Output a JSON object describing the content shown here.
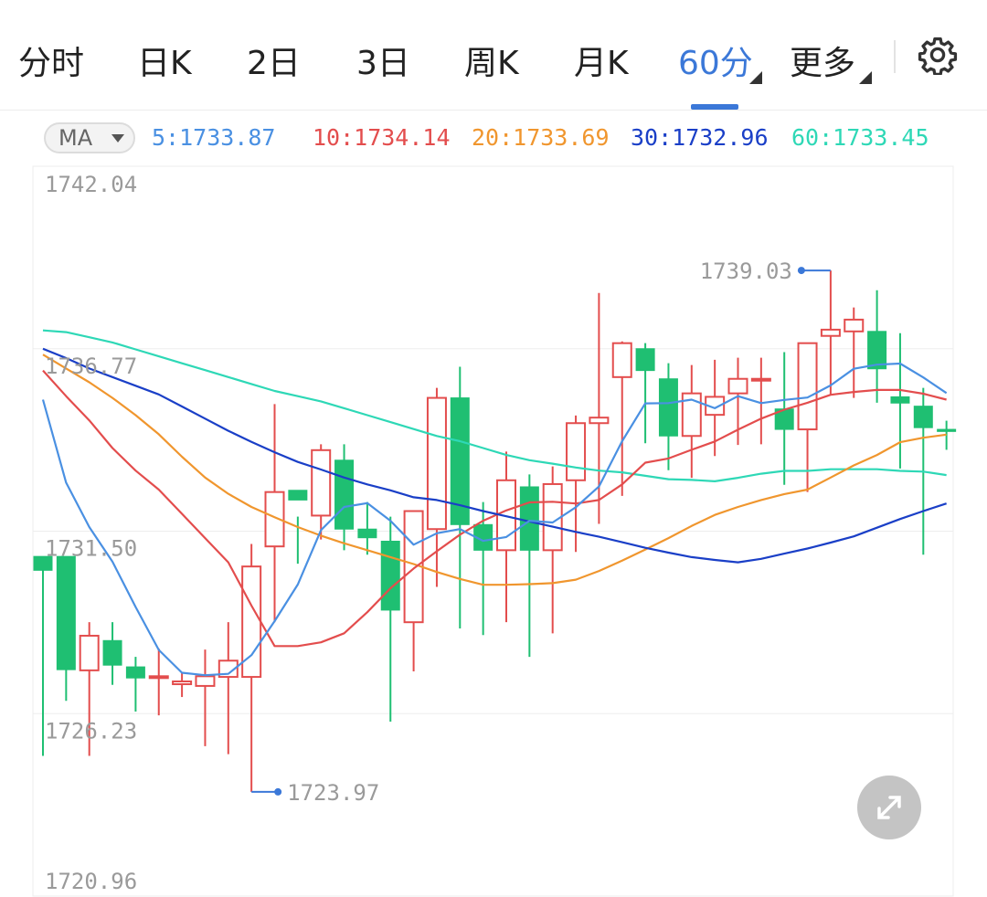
{
  "tabs": [
    {
      "label": "分时",
      "active": false
    },
    {
      "label": "日K",
      "active": false
    },
    {
      "label": "2日",
      "active": false
    },
    {
      "label": "3日",
      "active": false
    },
    {
      "label": "周K",
      "active": false
    },
    {
      "label": "月K",
      "active": false
    },
    {
      "label": "60分",
      "active": true
    },
    {
      "label": "更多",
      "active": false
    }
  ],
  "icons": {
    "settings": "gear-icon",
    "expand": "expand-arrows-icon",
    "dropdown": "caret-down-icon"
  },
  "indicator": {
    "label": "MA",
    "values": [
      {
        "text": "5:1733.87",
        "color": "#4a90e2"
      },
      {
        "text": "10:1734.14",
        "color": "#e34d4d"
      },
      {
        "text": "20:1733.69",
        "color": "#f0962e"
      },
      {
        "text": "30:1732.96",
        "color": "#1a3fc7"
      },
      {
        "text": "60:1733.45",
        "color": "#2ed8b6"
      }
    ]
  },
  "colors": {
    "up": "#e34d4d",
    "down": "#1fbf72",
    "accent": "#3b78d8"
  },
  "chart_data": {
    "type": "candlestick",
    "ylim": [
      1720.96,
      1742.04
    ],
    "y_ticks": [
      "1742.04",
      "1736.77",
      "1731.50",
      "1726.23",
      "1720.96"
    ],
    "annotations": {
      "high": "1739.03",
      "low": "1723.97"
    },
    "candles": [
      [
        1730.77,
        1730.37,
        1725.01,
        1730.77
      ],
      [
        1730.77,
        1727.5,
        1726.6,
        1730.77
      ],
      [
        1727.48,
        1728.48,
        1725.01,
        1728.87
      ],
      [
        1728.34,
        1727.63,
        1727.06,
        1728.87
      ],
      [
        1727.58,
        1727.26,
        1726.29,
        1727.87
      ],
      [
        1727.26,
        1727.31,
        1726.18,
        1728.11
      ],
      [
        1727.08,
        1727.16,
        1726.71,
        1727.4
      ],
      [
        1727.03,
        1727.31,
        1725.29,
        1728.08
      ],
      [
        1727.29,
        1727.76,
        1725.06,
        1728.87
      ],
      [
        1727.29,
        1730.48,
        1723.97,
        1731.13
      ],
      [
        1731.06,
        1732.63,
        1728.87,
        1735.17
      ],
      [
        1732.68,
        1732.4,
        1730.56,
        1731.92
      ],
      [
        1731.95,
        1733.84,
        1731.26,
        1734.01
      ],
      [
        1733.55,
        1731.56,
        1730.95,
        1734.01
      ],
      [
        1731.56,
        1731.31,
        1730.82,
        1732.34
      ],
      [
        1731.21,
        1729.22,
        1726.0,
        1731.92
      ],
      [
        1728.87,
        1732.08,
        1727.45,
        1731.92
      ],
      [
        1731.56,
        1735.35,
        1729.89,
        1735.64
      ],
      [
        1735.35,
        1731.69,
        1728.69,
        1736.25
      ],
      [
        1731.69,
        1730.95,
        1728.5,
        1732.34
      ],
      [
        1730.95,
        1732.97,
        1728.87,
        1733.8
      ],
      [
        1732.78,
        1730.95,
        1727.87,
        1733.14
      ],
      [
        1730.95,
        1732.86,
        1728.55,
        1733.37
      ],
      [
        1732.97,
        1734.62,
        1730.9,
        1734.84
      ],
      [
        1734.62,
        1734.78,
        1731.71,
        1738.38
      ],
      [
        1735.95,
        1736.93,
        1732.52,
        1736.98
      ],
      [
        1736.77,
        1736.14,
        1734.04,
        1736.93
      ],
      [
        1735.9,
        1734.25,
        1733.26,
        1736.35
      ],
      [
        1734.25,
        1735.48,
        1733.04,
        1736.3
      ],
      [
        1734.86,
        1735.38,
        1733.67,
        1736.45
      ],
      [
        1735.48,
        1735.9,
        1733.99,
        1736.51
      ],
      [
        1735.9,
        1735.9,
        1734.01,
        1736.51
      ],
      [
        1735.03,
        1734.44,
        1732.84,
        1736.67
      ],
      [
        1734.44,
        1736.93,
        1732.63,
        1736.93
      ],
      [
        1737.14,
        1737.32,
        1735.43,
        1739.03
      ],
      [
        1737.27,
        1737.61,
        1735.35,
        1737.96
      ],
      [
        1737.27,
        1736.19,
        1735.21,
        1738.46
      ],
      [
        1735.38,
        1735.2,
        1733.31,
        1737.22
      ],
      [
        1735.11,
        1734.49,
        1730.82,
        1735.64
      ],
      [
        1734.44,
        1734.38,
        1733.85,
        1734.69
      ]
    ],
    "series": [
      {
        "name": "5",
        "color": "#4a90e2",
        "values": [
          1735.3,
          1732.9,
          1731.62,
          1730.62,
          1729.31,
          1728.07,
          1727.41,
          1727.34,
          1727.38,
          1727.92,
          1728.9,
          1729.96,
          1731.53,
          1732.2,
          1732.31,
          1731.8,
          1731.11,
          1731.44,
          1731.56,
          1731.22,
          1731.33,
          1731.8,
          1731.75,
          1732.19,
          1732.79,
          1734.1,
          1735.19,
          1735.2,
          1735.3,
          1735.05,
          1735.4,
          1735.2,
          1735.29,
          1735.36,
          1735.71,
          1736.19,
          1736.31,
          1736.34,
          1735.94,
          1735.49
        ]
      },
      {
        "name": "10",
        "color": "#e34d4d",
        "values": [
          1736.14,
          1735.4,
          1734.7,
          1733.9,
          1733.25,
          1732.7,
          1732.0,
          1731.3,
          1730.6,
          1729.35,
          1728.18,
          1728.18,
          1728.29,
          1728.55,
          1729.16,
          1729.85,
          1730.42,
          1730.92,
          1731.4,
          1731.8,
          1732.1,
          1732.33,
          1732.35,
          1732.3,
          1732.4,
          1732.85,
          1733.48,
          1733.6,
          1733.85,
          1734.09,
          1734.43,
          1734.75,
          1735.01,
          1735.21,
          1735.44,
          1735.52,
          1735.58,
          1735.58,
          1735.47,
          1735.3
        ]
      },
      {
        "name": "20",
        "color": "#f0962e",
        "values": [
          1736.6,
          1736.2,
          1735.8,
          1735.35,
          1734.85,
          1734.3,
          1733.65,
          1733.05,
          1732.58,
          1732.2,
          1731.9,
          1731.62,
          1731.37,
          1731.15,
          1730.95,
          1730.75,
          1730.55,
          1730.32,
          1730.12,
          1729.95,
          1729.95,
          1729.97,
          1730.0,
          1730.1,
          1730.35,
          1730.65,
          1730.97,
          1731.3,
          1731.65,
          1731.97,
          1732.2,
          1732.4,
          1732.57,
          1732.7,
          1733.05,
          1733.4,
          1733.7,
          1734.07,
          1734.2,
          1734.29
        ]
      },
      {
        "name": "30",
        "color": "#1a3fc7",
        "values": [
          1736.77,
          1736.5,
          1736.2,
          1735.95,
          1735.7,
          1735.45,
          1735.1,
          1734.75,
          1734.4,
          1734.08,
          1733.78,
          1733.5,
          1733.28,
          1733.05,
          1732.85,
          1732.68,
          1732.48,
          1732.4,
          1732.25,
          1732.08,
          1731.93,
          1731.78,
          1731.63,
          1731.48,
          1731.34,
          1731.18,
          1731.02,
          1730.88,
          1730.75,
          1730.67,
          1730.6,
          1730.7,
          1730.85,
          1731.0,
          1731.17,
          1731.35,
          1731.6,
          1731.85,
          1732.08,
          1732.3
        ]
      },
      {
        "name": "60",
        "color": "#2ed8b6",
        "values": [
          1737.3,
          1737.25,
          1737.1,
          1736.95,
          1736.75,
          1736.55,
          1736.35,
          1736.15,
          1735.95,
          1735.75,
          1735.55,
          1735.4,
          1735.25,
          1735.05,
          1734.85,
          1734.65,
          1734.45,
          1734.25,
          1734.1,
          1733.9,
          1733.7,
          1733.55,
          1733.45,
          1733.34,
          1733.25,
          1733.2,
          1733.1,
          1733.0,
          1732.98,
          1732.94,
          1733.04,
          1733.16,
          1733.24,
          1733.24,
          1733.29,
          1733.29,
          1733.29,
          1733.24,
          1733.22,
          1733.12
        ]
      }
    ]
  }
}
